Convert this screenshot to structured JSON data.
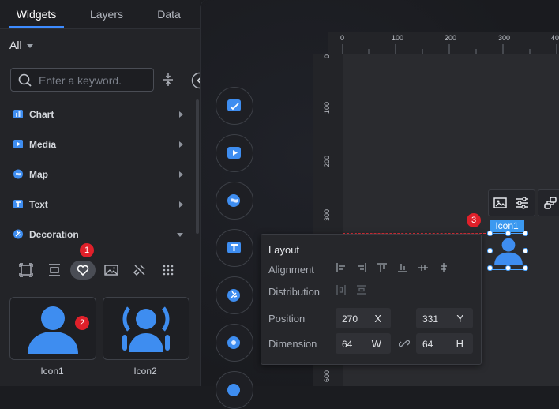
{
  "tabs": [
    {
      "label": "Widgets"
    },
    {
      "label": "Layers"
    },
    {
      "label": "Data"
    }
  ],
  "filter": {
    "label": "All"
  },
  "search": {
    "placeholder": "Enter a keyword."
  },
  "categories": [
    {
      "label": "Chart",
      "expanded": false
    },
    {
      "label": "Media",
      "expanded": false
    },
    {
      "label": "Map",
      "expanded": false
    },
    {
      "label": "Text",
      "expanded": false
    },
    {
      "label": "Decoration",
      "expanded": true
    }
  ],
  "decoration_tools": [
    "border-icon",
    "divider-icon",
    "heart-icon",
    "image-icon",
    "paint-brush-icon",
    "grid-dots-icon"
  ],
  "widgets": [
    {
      "label": "Icon1"
    },
    {
      "label": "Icon2"
    }
  ],
  "badges": {
    "one": "1",
    "two": "2",
    "three": "3"
  },
  "ruler": {
    "top": [
      "0",
      "100",
      "200",
      "300",
      "40"
    ],
    "left": [
      "0",
      "100",
      "200",
      "300",
      "600"
    ]
  },
  "layout_panel": {
    "title": "Layout",
    "alignment_label": "Alignment",
    "distribution_label": "Distribution",
    "position_label": "Position",
    "dimension_label": "Dimension",
    "x_value": "270",
    "x_unit": "X",
    "y_value": "331",
    "y_unit": "Y",
    "w_value": "64",
    "w_unit": "W",
    "h_value": "64",
    "h_unit": "H"
  },
  "selected": {
    "label": "Icon1"
  },
  "colors": {
    "accent": "#3d8bff",
    "badge": "#e0202a",
    "guide": "#e0303a",
    "icon_blue": "#3e8df0"
  }
}
